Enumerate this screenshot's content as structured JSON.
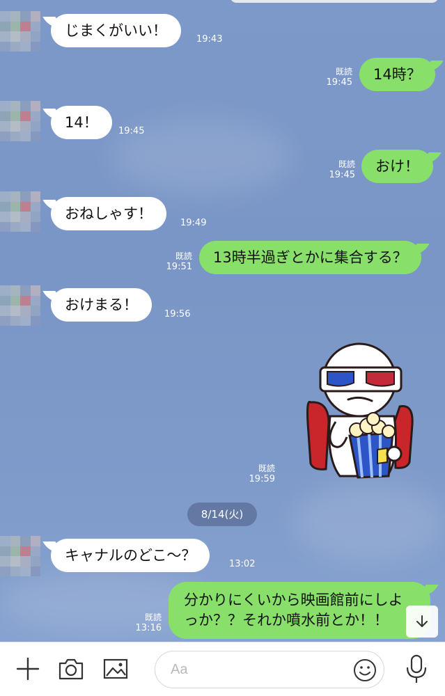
{
  "read_label": "既読",
  "messages": [
    {
      "text": "じまくがいい！",
      "time": "19:43"
    },
    {
      "text": "14時？",
      "time": "19:45"
    },
    {
      "text": "14！",
      "time": "19:45"
    },
    {
      "text": "おけ！",
      "time": "19:45"
    },
    {
      "text": "おねしゃす！",
      "time": "19:49"
    },
    {
      "text": "13時半過ぎとかに集合する？",
      "time": "19:51"
    },
    {
      "text": "おけまる！",
      "time": "19:56"
    },
    {
      "text": "",
      "time": "19:59"
    },
    {
      "text": "キャナルのどこ〜？",
      "time": "13:02"
    },
    {
      "text": "分かりにくいから映画館前にしよっか？？それか噴水前とか！！",
      "time": "13:16"
    }
  ],
  "date_separator": "8/14(火)",
  "input": {
    "placeholder": "Aa"
  },
  "icons": {
    "plus": "plus-icon",
    "camera": "camera-icon",
    "image": "image-icon",
    "emoji": "smiley-icon",
    "mic": "microphone-icon",
    "scroll": "arrow-down-icon"
  },
  "colors": {
    "background": "#7d99c9",
    "outgoing_bubble": "#88e06a",
    "incoming_bubble": "#ffffff",
    "date_pill": "#5a6e96"
  }
}
